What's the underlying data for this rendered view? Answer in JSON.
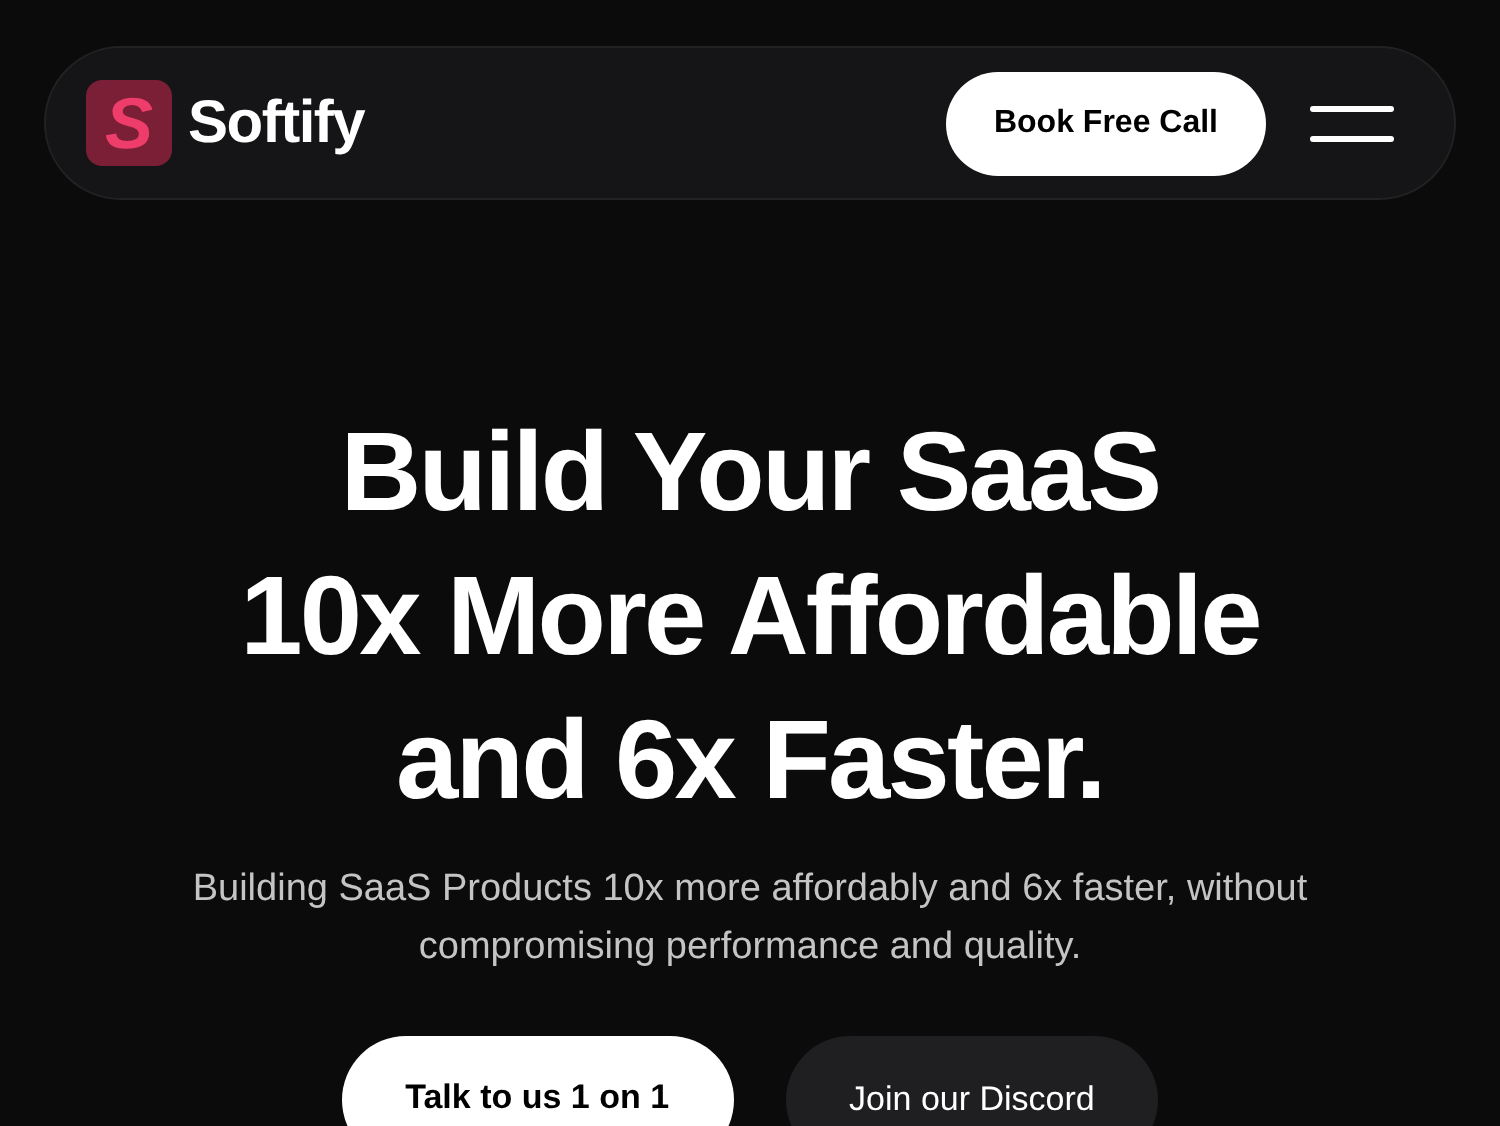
{
  "navbar": {
    "logo_mark": "S",
    "brand": "Softify",
    "cta": "Book Free Call"
  },
  "hero": {
    "headline_lines": [
      "Build Your SaaS",
      "10x More Affordable",
      "and 6x Faster."
    ],
    "subtitle": "Building SaaS Products 10x more affordably and 6x faster, without compromising performance and quality.",
    "buttons": [
      {
        "label": "Talk to us 1 on 1",
        "kind": "primary"
      },
      {
        "label": "Join our Discord",
        "kind": "secondary"
      }
    ]
  }
}
